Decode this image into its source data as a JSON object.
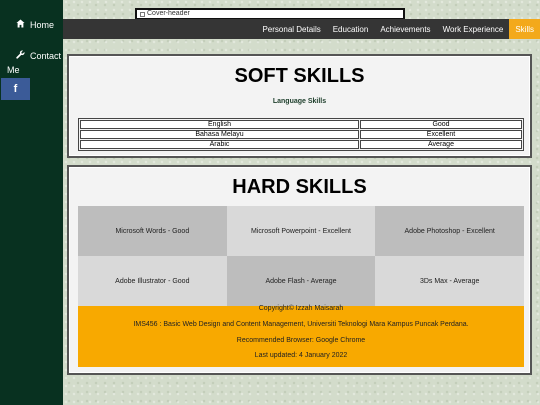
{
  "sidebar": {
    "home_label": "Home",
    "contact_label": "Contact",
    "contact_rest": "Me",
    "facebook_label": "f",
    "home_icon": "home-icon",
    "contact_icon": "wrench-icon"
  },
  "header": {
    "cover_alt": "Cover-header"
  },
  "nav": {
    "items": [
      {
        "label": "Personal Details"
      },
      {
        "label": "Education"
      },
      {
        "label": "Achievements"
      },
      {
        "label": "Work Experience"
      },
      {
        "label": "Skills"
      }
    ],
    "active_index": 4
  },
  "soft": {
    "title": "SOFT SKILLS",
    "subtitle": "Language Skills",
    "rows": [
      {
        "skill": "English",
        "level": "Good"
      },
      {
        "skill": "Bahasa Melayu",
        "level": "Excellent"
      },
      {
        "skill": "Arabic",
        "level": "Average"
      }
    ]
  },
  "hard": {
    "title": "HARD SKILLS",
    "cells": [
      "Microsoft Words - Good",
      "Microsoft Powerpoint - Excellent",
      "Adobe Photoshop - Excellent",
      "Adobe Illustrator - Good",
      "Adobe Flash - Average",
      "3Ds Max - Average"
    ]
  },
  "footer": {
    "copyright": "Copyright© Izzah Maisarah",
    "course": "IMS456 : Basic Web Design and Content Management, Universiti Teknologi Mara Kampus Puncak Perdana.",
    "browser": "Recommended Browser: Google Chrome",
    "updated": "Last updated: 4 January 2022"
  },
  "colors": {
    "sidebar": "#083120",
    "nav": "#353535",
    "accent": "#f3a91b",
    "facebook": "#3b5b98"
  }
}
